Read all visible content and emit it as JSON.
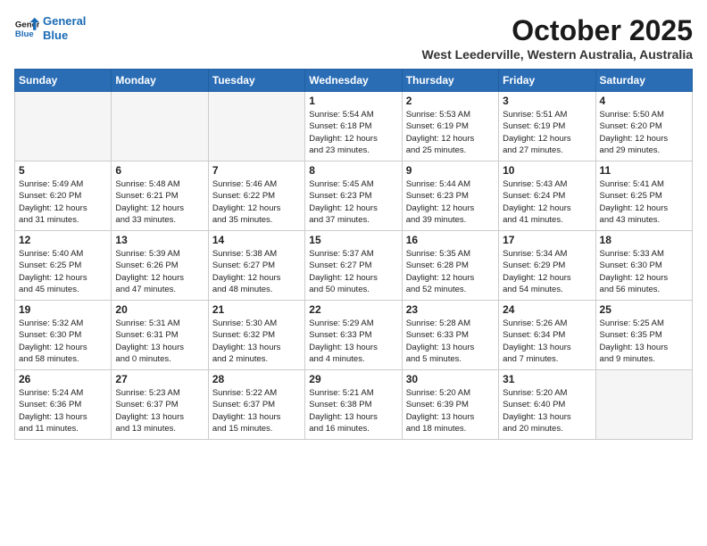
{
  "header": {
    "logo_line1": "General",
    "logo_line2": "Blue",
    "month": "October 2025",
    "location": "West Leederville, Western Australia, Australia"
  },
  "days_of_week": [
    "Sunday",
    "Monday",
    "Tuesday",
    "Wednesday",
    "Thursday",
    "Friday",
    "Saturday"
  ],
  "weeks": [
    [
      {
        "day": "",
        "info": ""
      },
      {
        "day": "",
        "info": ""
      },
      {
        "day": "",
        "info": ""
      },
      {
        "day": "1",
        "info": "Sunrise: 5:54 AM\nSunset: 6:18 PM\nDaylight: 12 hours\nand 23 minutes."
      },
      {
        "day": "2",
        "info": "Sunrise: 5:53 AM\nSunset: 6:19 PM\nDaylight: 12 hours\nand 25 minutes."
      },
      {
        "day": "3",
        "info": "Sunrise: 5:51 AM\nSunset: 6:19 PM\nDaylight: 12 hours\nand 27 minutes."
      },
      {
        "day": "4",
        "info": "Sunrise: 5:50 AM\nSunset: 6:20 PM\nDaylight: 12 hours\nand 29 minutes."
      }
    ],
    [
      {
        "day": "5",
        "info": "Sunrise: 5:49 AM\nSunset: 6:20 PM\nDaylight: 12 hours\nand 31 minutes."
      },
      {
        "day": "6",
        "info": "Sunrise: 5:48 AM\nSunset: 6:21 PM\nDaylight: 12 hours\nand 33 minutes."
      },
      {
        "day": "7",
        "info": "Sunrise: 5:46 AM\nSunset: 6:22 PM\nDaylight: 12 hours\nand 35 minutes."
      },
      {
        "day": "8",
        "info": "Sunrise: 5:45 AM\nSunset: 6:23 PM\nDaylight: 12 hours\nand 37 minutes."
      },
      {
        "day": "9",
        "info": "Sunrise: 5:44 AM\nSunset: 6:23 PM\nDaylight: 12 hours\nand 39 minutes."
      },
      {
        "day": "10",
        "info": "Sunrise: 5:43 AM\nSunset: 6:24 PM\nDaylight: 12 hours\nand 41 minutes."
      },
      {
        "day": "11",
        "info": "Sunrise: 5:41 AM\nSunset: 6:25 PM\nDaylight: 12 hours\nand 43 minutes."
      }
    ],
    [
      {
        "day": "12",
        "info": "Sunrise: 5:40 AM\nSunset: 6:25 PM\nDaylight: 12 hours\nand 45 minutes."
      },
      {
        "day": "13",
        "info": "Sunrise: 5:39 AM\nSunset: 6:26 PM\nDaylight: 12 hours\nand 47 minutes."
      },
      {
        "day": "14",
        "info": "Sunrise: 5:38 AM\nSunset: 6:27 PM\nDaylight: 12 hours\nand 48 minutes."
      },
      {
        "day": "15",
        "info": "Sunrise: 5:37 AM\nSunset: 6:27 PM\nDaylight: 12 hours\nand 50 minutes."
      },
      {
        "day": "16",
        "info": "Sunrise: 5:35 AM\nSunset: 6:28 PM\nDaylight: 12 hours\nand 52 minutes."
      },
      {
        "day": "17",
        "info": "Sunrise: 5:34 AM\nSunset: 6:29 PM\nDaylight: 12 hours\nand 54 minutes."
      },
      {
        "day": "18",
        "info": "Sunrise: 5:33 AM\nSunset: 6:30 PM\nDaylight: 12 hours\nand 56 minutes."
      }
    ],
    [
      {
        "day": "19",
        "info": "Sunrise: 5:32 AM\nSunset: 6:30 PM\nDaylight: 12 hours\nand 58 minutes."
      },
      {
        "day": "20",
        "info": "Sunrise: 5:31 AM\nSunset: 6:31 PM\nDaylight: 13 hours\nand 0 minutes."
      },
      {
        "day": "21",
        "info": "Sunrise: 5:30 AM\nSunset: 6:32 PM\nDaylight: 13 hours\nand 2 minutes."
      },
      {
        "day": "22",
        "info": "Sunrise: 5:29 AM\nSunset: 6:33 PM\nDaylight: 13 hours\nand 4 minutes."
      },
      {
        "day": "23",
        "info": "Sunrise: 5:28 AM\nSunset: 6:33 PM\nDaylight: 13 hours\nand 5 minutes."
      },
      {
        "day": "24",
        "info": "Sunrise: 5:26 AM\nSunset: 6:34 PM\nDaylight: 13 hours\nand 7 minutes."
      },
      {
        "day": "25",
        "info": "Sunrise: 5:25 AM\nSunset: 6:35 PM\nDaylight: 13 hours\nand 9 minutes."
      }
    ],
    [
      {
        "day": "26",
        "info": "Sunrise: 5:24 AM\nSunset: 6:36 PM\nDaylight: 13 hours\nand 11 minutes."
      },
      {
        "day": "27",
        "info": "Sunrise: 5:23 AM\nSunset: 6:37 PM\nDaylight: 13 hours\nand 13 minutes."
      },
      {
        "day": "28",
        "info": "Sunrise: 5:22 AM\nSunset: 6:37 PM\nDaylight: 13 hours\nand 15 minutes."
      },
      {
        "day": "29",
        "info": "Sunrise: 5:21 AM\nSunset: 6:38 PM\nDaylight: 13 hours\nand 16 minutes."
      },
      {
        "day": "30",
        "info": "Sunrise: 5:20 AM\nSunset: 6:39 PM\nDaylight: 13 hours\nand 18 minutes."
      },
      {
        "day": "31",
        "info": "Sunrise: 5:20 AM\nSunset: 6:40 PM\nDaylight: 13 hours\nand 20 minutes."
      },
      {
        "day": "",
        "info": ""
      }
    ]
  ]
}
